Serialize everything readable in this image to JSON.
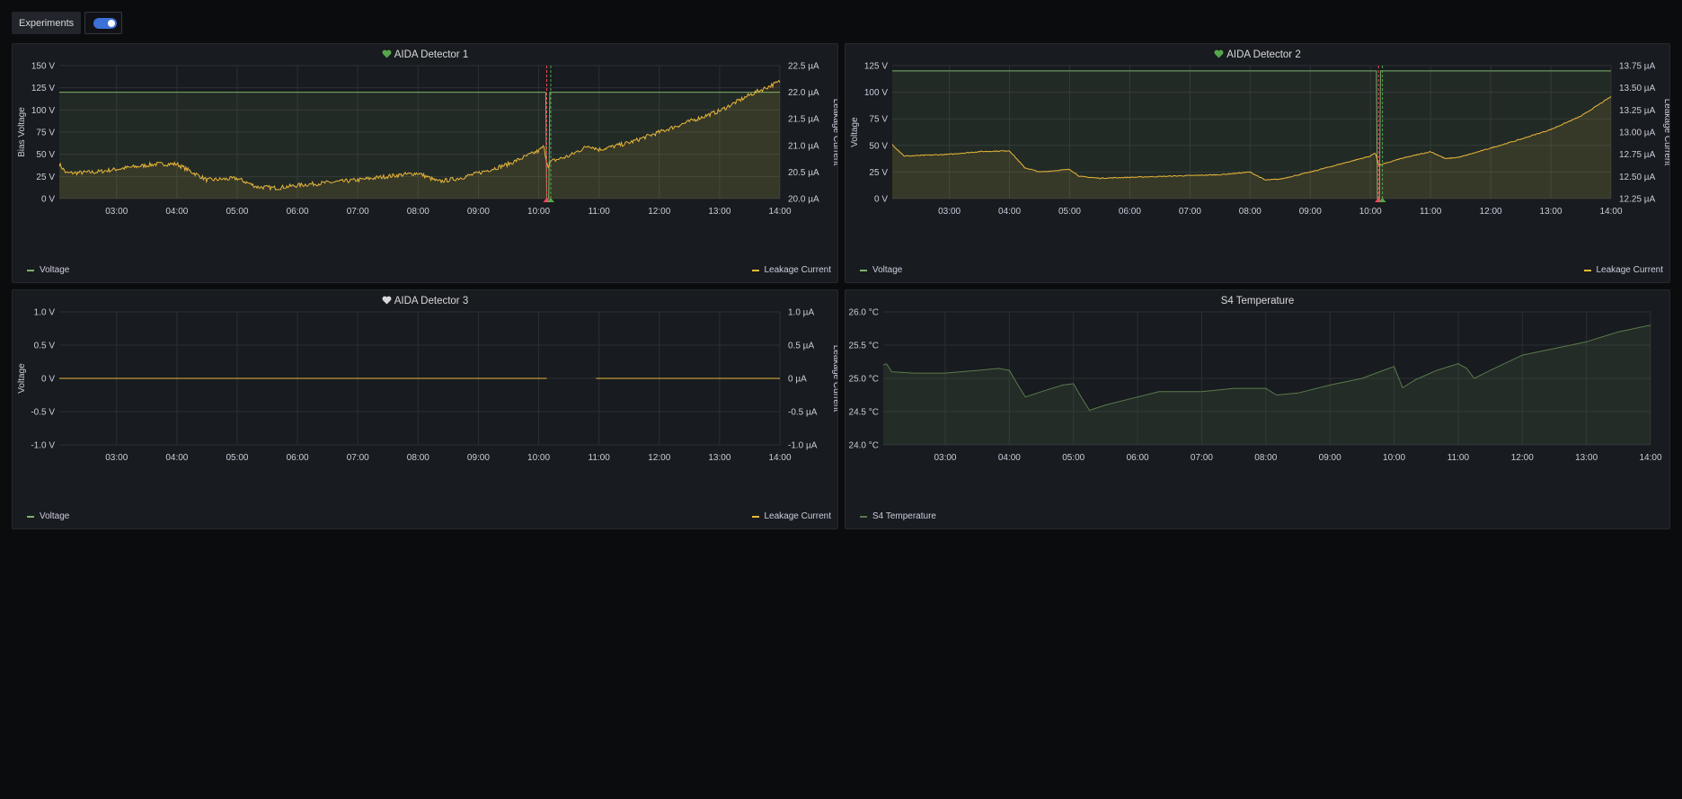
{
  "topbar": {
    "variable_label": "Experiments",
    "toggle_on": true
  },
  "colors": {
    "voltage": "#7EB26D",
    "current": "#EAB839",
    "temperature": "#5a7a4c",
    "accent": "#3d71d9",
    "heart_ok": "#56a64b",
    "heart_none": "#d8d9da",
    "annotation": "#f2495c"
  },
  "panels": [
    {
      "title": "AIDA Detector 1",
      "status_icon": "heart-green-icon",
      "legend_left": "Voltage",
      "legend_right": "Leakage Current"
    },
    {
      "title": "AIDA Detector 2",
      "status_icon": "heart-green-icon",
      "legend_left": "Voltage",
      "legend_right": "Leakage Current"
    },
    {
      "title": "AIDA Detector 3",
      "status_icon": "heart-white-icon",
      "legend_left": "Voltage",
      "legend_right": "Leakage Current"
    },
    {
      "title": "S4 Temperature",
      "status_icon": "",
      "legend_left": "S4 Temperature",
      "legend_right": ""
    }
  ],
  "chart_data": [
    {
      "type": "line",
      "title": "AIDA Detector 1",
      "x_ticks": [
        "03:00",
        "04:00",
        "05:00",
        "06:00",
        "07:00",
        "08:00",
        "09:00",
        "10:00",
        "11:00",
        "12:00",
        "13:00",
        "14:00"
      ],
      "x_range": [
        "02:03",
        "14:00"
      ],
      "y_left": {
        "label": "Bias Voltage",
        "ticks": [
          "0 V",
          "25 V",
          "50 V",
          "75 V",
          "100 V",
          "125 V",
          "150 V"
        ],
        "range": [
          0,
          150
        ],
        "unit": "V"
      },
      "y_right": {
        "label": "Leakage Current",
        "ticks": [
          "20.0 µA",
          "20.5 µA",
          "21.0 µA",
          "21.5 µA",
          "22.0 µA",
          "22.5 µA"
        ],
        "range": [
          20.0,
          22.5
        ],
        "unit": "µA"
      },
      "annotations": [
        "10:08",
        "10:12"
      ],
      "series": [
        {
          "name": "Voltage",
          "axis": "left",
          "points": [
            [
              "02:03",
              120
            ],
            [
              "10:07",
              120
            ],
            [
              "10:08",
              0
            ],
            [
              "10:10",
              0
            ],
            [
              "10:11",
              120
            ],
            [
              "14:00",
              120
            ]
          ]
        },
        {
          "name": "Leakage Current",
          "axis": "right",
          "noise": 0.04,
          "points": [
            [
              "02:03",
              20.65
            ],
            [
              "02:10",
              20.48
            ],
            [
              "02:40",
              20.5
            ],
            [
              "03:10",
              20.58
            ],
            [
              "03:40",
              20.65
            ],
            [
              "04:00",
              20.65
            ],
            [
              "04:30",
              20.35
            ],
            [
              "05:00",
              20.38
            ],
            [
              "05:20",
              20.22
            ],
            [
              "05:40",
              20.2
            ],
            [
              "06:00",
              20.25
            ],
            [
              "06:30",
              20.3
            ],
            [
              "07:00",
              20.35
            ],
            [
              "07:30",
              20.42
            ],
            [
              "08:00",
              20.48
            ],
            [
              "08:20",
              20.32
            ],
            [
              "08:40",
              20.38
            ],
            [
              "09:00",
              20.48
            ],
            [
              "09:30",
              20.65
            ],
            [
              "10:00",
              20.9
            ],
            [
              "10:05",
              20.98
            ],
            [
              "10:08",
              20.7
            ],
            [
              "10:10",
              20.6
            ],
            [
              "10:12",
              20.7
            ],
            [
              "10:30",
              20.8
            ],
            [
              "10:50",
              21.0
            ],
            [
              "11:00",
              20.92
            ],
            [
              "11:30",
              21.05
            ],
            [
              "12:00",
              21.25
            ],
            [
              "12:30",
              21.45
            ],
            [
              "13:00",
              21.65
            ],
            [
              "13:30",
              21.95
            ],
            [
              "14:00",
              22.2
            ]
          ]
        }
      ]
    },
    {
      "type": "line",
      "title": "AIDA Detector 2",
      "x_ticks": [
        "03:00",
        "04:00",
        "05:00",
        "06:00",
        "07:00",
        "08:00",
        "09:00",
        "10:00",
        "11:00",
        "12:00",
        "13:00",
        "14:00"
      ],
      "x_range": [
        "02:03",
        "14:00"
      ],
      "y_left": {
        "label": "Voltage",
        "ticks": [
          "0 V",
          "25 V",
          "50 V",
          "75 V",
          "100 V",
          "125 V"
        ],
        "range": [
          0,
          125
        ],
        "unit": "V"
      },
      "y_right": {
        "label": "Leakage Current",
        "ticks": [
          "12.25 µA",
          "12.50 µA",
          "12.75 µA",
          "13.00 µA",
          "13.25 µA",
          "13.50 µA",
          "13.75 µA"
        ],
        "range": [
          12.25,
          13.75
        ],
        "unit": "µA"
      },
      "annotations": [
        "10:08",
        "10:12"
      ],
      "series": [
        {
          "name": "Voltage",
          "axis": "left",
          "points": [
            [
              "02:03",
              120
            ],
            [
              "10:06",
              120
            ],
            [
              "10:07",
              0
            ],
            [
              "10:09",
              0
            ],
            [
              "10:10",
              120
            ],
            [
              "14:00",
              120
            ]
          ]
        },
        {
          "name": "Leakage Current",
          "axis": "right",
          "noise": 0.005,
          "points": [
            [
              "02:03",
              12.86
            ],
            [
              "02:15",
              12.73
            ],
            [
              "03:00",
              12.75
            ],
            [
              "03:30",
              12.78
            ],
            [
              "04:00",
              12.79
            ],
            [
              "04:15",
              12.6
            ],
            [
              "04:30",
              12.55
            ],
            [
              "05:00",
              12.58
            ],
            [
              "05:10",
              12.5
            ],
            [
              "05:30",
              12.48
            ],
            [
              "06:00",
              12.49
            ],
            [
              "06:30",
              12.5
            ],
            [
              "07:00",
              12.51
            ],
            [
              "07:30",
              12.52
            ],
            [
              "08:00",
              12.55
            ],
            [
              "08:15",
              12.46
            ],
            [
              "08:30",
              12.47
            ],
            [
              "09:00",
              12.55
            ],
            [
              "09:30",
              12.64
            ],
            [
              "10:00",
              12.73
            ],
            [
              "10:05",
              12.77
            ],
            [
              "10:08",
              12.63
            ],
            [
              "10:10",
              12.63
            ],
            [
              "10:30",
              12.7
            ],
            [
              "11:00",
              12.78
            ],
            [
              "11:15",
              12.7
            ],
            [
              "11:30",
              12.72
            ],
            [
              "12:00",
              12.82
            ],
            [
              "12:30",
              12.92
            ],
            [
              "13:00",
              13.03
            ],
            [
              "13:30",
              13.18
            ],
            [
              "14:00",
              13.4
            ]
          ]
        }
      ]
    },
    {
      "type": "line",
      "title": "AIDA Detector 3",
      "x_ticks": [
        "03:00",
        "04:00",
        "05:00",
        "06:00",
        "07:00",
        "08:00",
        "09:00",
        "10:00",
        "11:00",
        "12:00",
        "13:00",
        "14:00"
      ],
      "x_range": [
        "02:03",
        "14:00"
      ],
      "y_left": {
        "label": "Voltage",
        "ticks": [
          "-1.0 V",
          "-0.5 V",
          "0 V",
          "0.5 V",
          "1.0 V"
        ],
        "range": [
          -1,
          1
        ],
        "unit": "V"
      },
      "y_right": {
        "label": "Leakage Current",
        "ticks": [
          "-1.0 µA",
          "-0.5 µA",
          "0 µA",
          "0.5 µA",
          "1.0 µA"
        ],
        "range": [
          -1,
          1
        ],
        "unit": "µA"
      },
      "annotations": [],
      "series": [
        {
          "name": "Voltage",
          "axis": "left",
          "segments": [
            [
              [
                "02:03",
                0
              ],
              [
                "10:08",
                0
              ]
            ],
            [
              [
                "10:57",
                0
              ],
              [
                "14:00",
                0
              ]
            ]
          ]
        },
        {
          "name": "Leakage Current",
          "axis": "right",
          "segments": [
            [
              [
                "02:03",
                0
              ],
              [
                "10:08",
                0
              ]
            ],
            [
              [
                "10:57",
                0
              ],
              [
                "14:00",
                0
              ]
            ]
          ]
        }
      ]
    },
    {
      "type": "area",
      "title": "S4 Temperature",
      "x_ticks": [
        "03:00",
        "04:00",
        "05:00",
        "06:00",
        "07:00",
        "08:00",
        "09:00",
        "10:00",
        "11:00",
        "12:00",
        "13:00",
        "14:00"
      ],
      "x_range": [
        "02:02",
        "14:00"
      ],
      "y_left": {
        "label": "",
        "ticks": [
          "24.0 °C",
          "24.5 °C",
          "25.0 °C",
          "25.5 °C",
          "26.0 °C"
        ],
        "range": [
          24,
          26
        ],
        "unit": "°C"
      },
      "series": [
        {
          "name": "S4 Temperature",
          "axis": "left",
          "points": [
            [
              "02:02",
              25.2
            ],
            [
              "02:05",
              25.22
            ],
            [
              "02:10",
              25.1
            ],
            [
              "02:30",
              25.08
            ],
            [
              "03:00",
              25.08
            ],
            [
              "03:30",
              25.12
            ],
            [
              "03:50",
              25.15
            ],
            [
              "04:00",
              25.12
            ],
            [
              "04:08",
              24.9
            ],
            [
              "04:15",
              24.72
            ],
            [
              "04:30",
              24.8
            ],
            [
              "04:50",
              24.9
            ],
            [
              "05:00",
              24.92
            ],
            [
              "05:08",
              24.7
            ],
            [
              "05:15",
              24.52
            ],
            [
              "05:30",
              24.6
            ],
            [
              "06:00",
              24.72
            ],
            [
              "06:20",
              24.8
            ],
            [
              "06:40",
              24.8
            ],
            [
              "07:00",
              24.8
            ],
            [
              "07:30",
              24.85
            ],
            [
              "08:00",
              24.85
            ],
            [
              "08:10",
              24.75
            ],
            [
              "08:30",
              24.78
            ],
            [
              "09:00",
              24.9
            ],
            [
              "09:30",
              25.0
            ],
            [
              "09:50",
              25.12
            ],
            [
              "10:00",
              25.18
            ],
            [
              "10:08",
              24.86
            ],
            [
              "10:20",
              24.98
            ],
            [
              "10:40",
              25.12
            ],
            [
              "11:00",
              25.22
            ],
            [
              "11:08",
              25.15
            ],
            [
              "11:15",
              25.0
            ],
            [
              "11:30",
              25.12
            ],
            [
              "12:00",
              25.35
            ],
            [
              "12:30",
              25.45
            ],
            [
              "13:00",
              25.55
            ],
            [
              "13:30",
              25.7
            ],
            [
              "14:00",
              25.8
            ]
          ]
        }
      ]
    }
  ]
}
